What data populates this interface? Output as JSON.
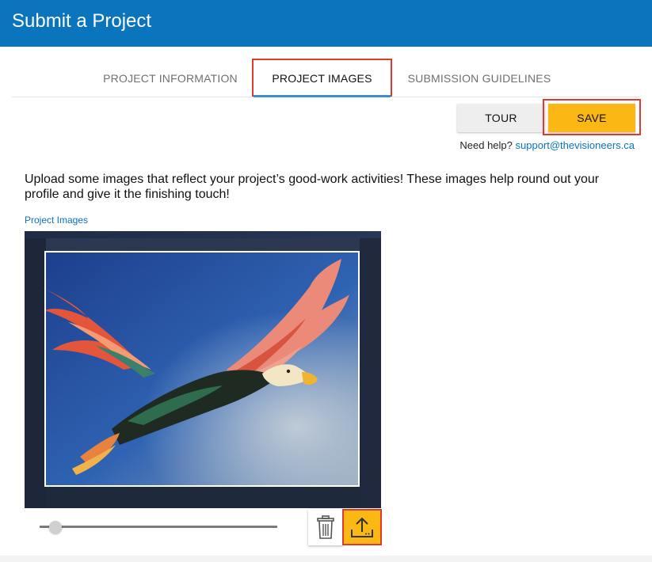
{
  "header": {
    "title": "Submit a Project"
  },
  "tabs": [
    {
      "label": "PROJECT INFORMATION"
    },
    {
      "label": "PROJECT IMAGES"
    },
    {
      "label": "SUBMISSION GUIDELINES"
    }
  ],
  "toolbar": {
    "tour_label": "TOUR",
    "save_label": "SAVE"
  },
  "help": {
    "prefix": "Need help?",
    "email": "support@thevisioneers.ca"
  },
  "intro": "Upload some images that reflect your project’s good-work activities! These images help round out your profile and give it the finishing touch!",
  "images_field": {
    "label": "Project Images",
    "zoom_fraction": 0.06
  },
  "icons": {
    "delete": "trash-icon",
    "upload": "upload-icon"
  },
  "colors": {
    "brand": "#0a74bd",
    "save": "#fbb814",
    "highlight": "#e03a2f"
  }
}
